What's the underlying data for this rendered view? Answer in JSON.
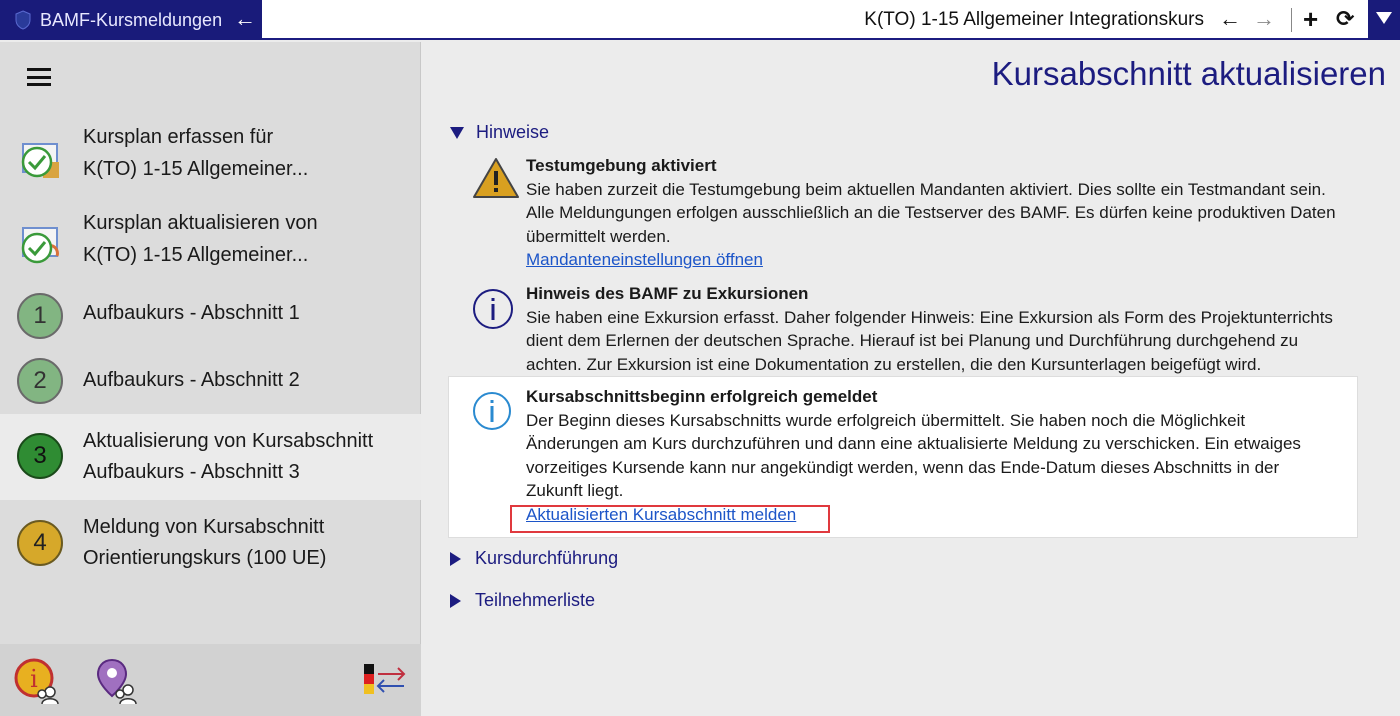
{
  "titlebar": {
    "app_title": "BAMF-Kursmeldungen",
    "back_icon": "arrow-left-icon",
    "course_title": "K(TO) 1-15 Allgemeiner Integrationskurs",
    "nav_back": "←",
    "nav_forward": "→",
    "add": "+",
    "refresh": "⟳"
  },
  "sidebar": {
    "items": [
      {
        "line1": "Kursplan erfassen für",
        "line2": "K(TO) 1-15 Allgemeiner...",
        "icon": "calendar-check-icon"
      },
      {
        "line1": "Kursplan aktualisieren von",
        "line2": "K(TO) 1-15 Allgemeiner...",
        "icon": "calendar-refresh-icon"
      },
      {
        "number": "1",
        "line1": "Aufbaukurs - Abschnitt 1",
        "color": "#82b582"
      },
      {
        "number": "2",
        "line1": "Aufbaukurs - Abschnitt 2",
        "color": "#82b582"
      },
      {
        "number": "3",
        "line1": "Aktualisierung von Kursabschnitt",
        "line2": "Aufbaukurs - Abschnitt 3",
        "color": "#2f8c33"
      },
      {
        "number": "4",
        "line1": "Meldung von Kursabschnitt",
        "line2": "Orientierungskurs (100 UE)",
        "color": "#d6a82a"
      }
    ],
    "bottom_icons": [
      "info-people-icon",
      "location-people-icon",
      "language-switch-icon"
    ]
  },
  "main": {
    "page_title": "Kursabschnitt aktualisieren",
    "sections": {
      "hinweise": "Hinweise",
      "kursdurchfuehrung": "Kursdurchführung",
      "teilnehmerliste": "Teilnehmerliste"
    },
    "notices": [
      {
        "icon": "warning-icon",
        "title": "Testumgebung aktiviert",
        "lines": [
          "Sie haben zurzeit die Testumgebung beim aktuellen Mandanten aktiviert. Dies sollte ein Testmandant sein.",
          "Alle Meldungungen erfolgen ausschließlich an die Testserver des BAMF. Es dürfen keine produktiven Daten",
          "übermittelt werden."
        ],
        "link": "Mandanteneinstellungen öffnen"
      },
      {
        "icon": "info-icon",
        "title": "Hinweis des BAMF zu Exkursionen",
        "lines": [
          "Sie haben eine Exkursion erfasst. Daher folgender Hinweis: Eine Exkursion als Form des Projektunterrichts",
          "dient dem Erlernen der deutschen Sprache. Hierauf ist bei Planung und Durchführung durchgehend zu",
          "achten. Zur Exkursion ist eine Dokumentation zu erstellen, die den Kursunterlagen beigefügt wird."
        ]
      },
      {
        "icon": "info-icon",
        "title": "Kursabschnittsbeginn erfolgreich gemeldet",
        "lines": [
          "Der Beginn dieses Kursabschnitts wurde erfolgreich übermittelt. Sie haben noch die Möglichkeit",
          "Änderungen am Kurs durchzuführen und dann eine aktualisierte Meldung zu verschicken. Ein etwaiges",
          "vorzeitiges Kursende kann nur angekündigt werden, wenn das Ende-Datum dieses Abschnitts in der",
          "Zukunft liegt."
        ],
        "link": "Aktualisierten Kursabschnitt melden"
      }
    ]
  },
  "colors": {
    "brand": "#191b7a",
    "highlight_border": "#e0393e",
    "link": "#1c55c8"
  }
}
